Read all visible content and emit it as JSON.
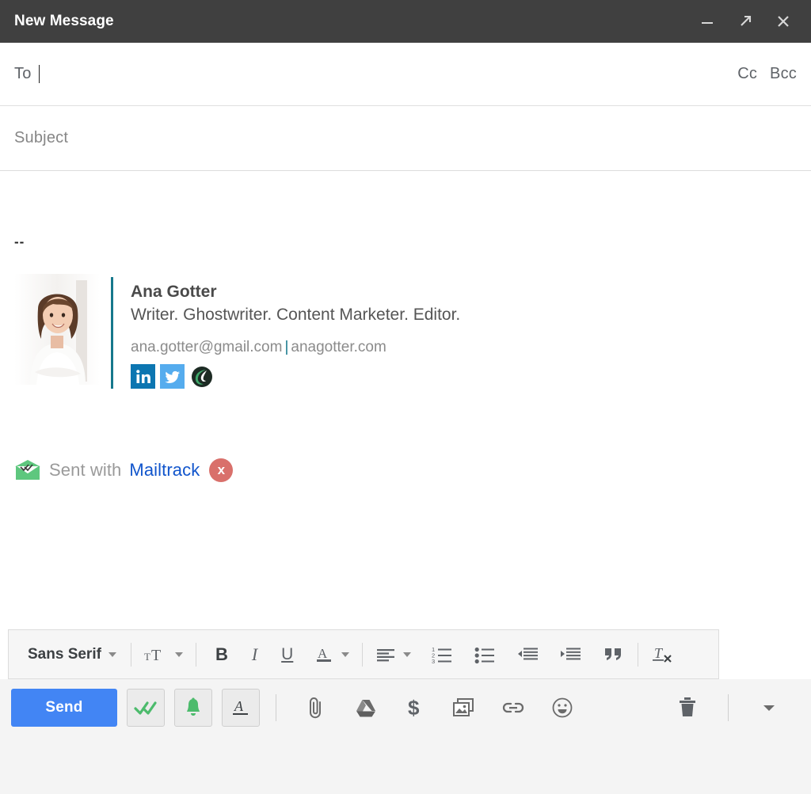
{
  "window": {
    "title": "New Message",
    "minimize_icon": "minimize-icon",
    "popout_icon": "popout-arrow-icon",
    "close_icon": "close-icon"
  },
  "compose": {
    "to_label": "To",
    "to_value": "",
    "cc_label": "Cc",
    "bcc_label": "Bcc",
    "subject_placeholder": "Subject",
    "subject_value": "",
    "body_signature_marker": "--"
  },
  "signature": {
    "name": "Ana Gotter",
    "tagline": "Writer. Ghostwriter. Content Marketer. Editor.",
    "email": "ana.gotter@gmail.com",
    "separator": "|",
    "website": "anagotter.com",
    "accent_color": "#16788c",
    "social": [
      {
        "name": "linkedin-icon",
        "label": "in",
        "color": "#0c76b1"
      },
      {
        "name": "twitter-icon",
        "label": "Twitter",
        "color": "#55acee"
      },
      {
        "name": "brand-logo-icon",
        "label": "Brand",
        "color": "#2f7d4f"
      }
    ]
  },
  "mailtrack": {
    "envelope_icon": "mailtrack-envelope-icon",
    "prefix": "Sent with",
    "link": "Mailtrack",
    "badge": "x",
    "badge_color": "#d9706b",
    "link_color": "#1155cc"
  },
  "format_toolbar": {
    "font_label": "Sans Serif",
    "items": [
      {
        "name": "font-family-dropdown",
        "label": "Sans Serif"
      },
      {
        "name": "font-size-button",
        "label": "Size"
      },
      {
        "name": "bold-button",
        "label": "B"
      },
      {
        "name": "italic-button",
        "label": "I"
      },
      {
        "name": "underline-button",
        "label": "U"
      },
      {
        "name": "text-color-button",
        "label": "A"
      },
      {
        "name": "align-button",
        "label": "Align"
      },
      {
        "name": "numbered-list-button",
        "label": "Numbered list"
      },
      {
        "name": "bulleted-list-button",
        "label": "Bulleted list"
      },
      {
        "name": "outdent-button",
        "label": "Outdent"
      },
      {
        "name": "indent-button",
        "label": "Indent"
      },
      {
        "name": "quote-button",
        "label": "Quote"
      },
      {
        "name": "remove-formatting-button",
        "label": "Remove formatting"
      }
    ],
    "bold_label": "B",
    "italic_label": "I",
    "underline_label": "U",
    "color_label": "A"
  },
  "action_bar": {
    "send_label": "Send",
    "send_color": "#4285f4",
    "toggles": [
      {
        "name": "mailtrack-tracking-toggle",
        "label": "Tracking",
        "color": "#4cbb6c"
      },
      {
        "name": "mailtrack-reminder-toggle",
        "label": "Reminder",
        "color": "#4cbb6c"
      },
      {
        "name": "formatting-options-toggle",
        "label": "A",
        "color": "#3c4043"
      }
    ],
    "icons": [
      {
        "name": "attach-file-icon",
        "label": "Attach files"
      },
      {
        "name": "google-drive-icon",
        "label": "Insert files using Drive"
      },
      {
        "name": "insert-money-icon",
        "label": "Insert money"
      },
      {
        "name": "insert-photo-icon",
        "label": "Insert photo"
      },
      {
        "name": "insert-link-icon",
        "label": "Insert link"
      },
      {
        "name": "insert-emoji-icon",
        "label": "Insert emoji"
      }
    ],
    "discard_icon": "trash-icon",
    "more_options_icon": "more-options-caret-icon"
  }
}
